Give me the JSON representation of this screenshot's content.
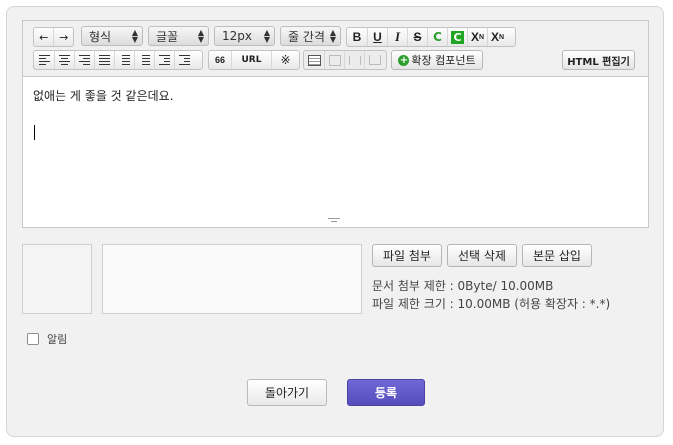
{
  "toolbar": {
    "undo_icon": "←",
    "redo_icon": "→",
    "format_select": "형식",
    "font_select": "글꼴",
    "size_select": "12px",
    "line_height_select": "줄 간격",
    "bold": "B",
    "underline": "U",
    "italic": "I",
    "strike": "S",
    "font_color": "C",
    "bg_color": "C",
    "superscript": "X",
    "superscript_mark": "N",
    "subscript": "X",
    "subscript_mark": "N",
    "quote": "66",
    "url": "URL",
    "special_char": "※",
    "extension_component": "확장 컴포넌트",
    "html_editor": "HTML 편집기"
  },
  "editor": {
    "content": "없애는 게 좋을 것 같은데요."
  },
  "attachments": {
    "attach_button": "파일 첨부",
    "delete_selected_button": "선택 삭제",
    "insert_body_button": "본문 삽입",
    "doc_limit": "문서 첨부 제한 : 0Byte/ 10.00MB",
    "file_limit": "파일 제한 크기 : 10.00MB (허용 확장자 : *.*)"
  },
  "options": {
    "notify_label": "알림"
  },
  "actions": {
    "back_button": "돌아가기",
    "submit_button": "등록"
  },
  "colors": {
    "submit_bg": "#5f56c8",
    "green_icon": "#22a522"
  }
}
